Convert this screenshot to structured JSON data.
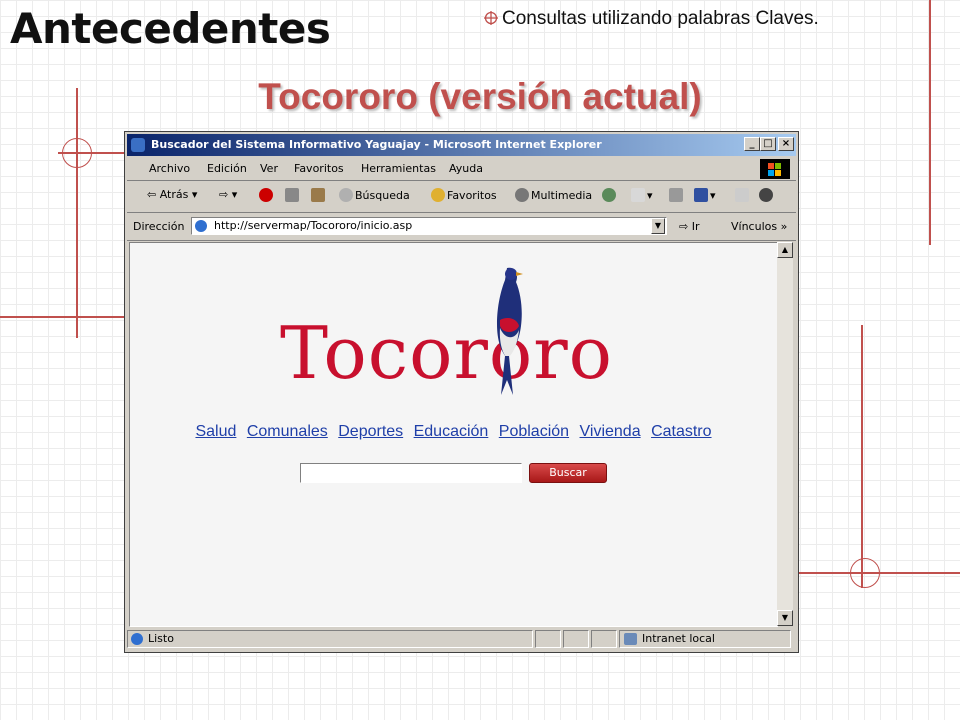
{
  "slide": {
    "title": "Antecedentes",
    "subtitle": "Consultas utilizando palabras Claves.",
    "heading": "Tocororo (versión actual)"
  },
  "browser": {
    "title": "Buscador del Sistema Informativo Yaguajay - Microsoft Internet Explorer",
    "controls": {
      "minimize": "_",
      "maximize": "□",
      "close": "×"
    },
    "menu": [
      "Archivo",
      "Edición",
      "Ver",
      "Favoritos",
      "Herramientas",
      "Ayuda"
    ],
    "toolbar": {
      "back": "Atrás",
      "search": "Búsqueda",
      "favorites": "Favoritos",
      "media": "Multimedia"
    },
    "address": {
      "label": "Dirección",
      "url": "http://servermap/Tocororo/inicio.asp",
      "go": "Ir",
      "links": "Vínculos"
    },
    "status": {
      "text": "Listo",
      "zone": "Intranet local"
    }
  },
  "page": {
    "logo_text": "Tocororo",
    "nav_links": [
      "Salud",
      "Comunales",
      "Deportes",
      "Educación",
      "Población",
      "Vivienda",
      "Catastro"
    ],
    "search_button": "Buscar",
    "search_value": ""
  },
  "colors": {
    "accent": "#c0504d",
    "titlebar": "#0a246a",
    "link": "#1f3fa8",
    "logo": "#c8102e"
  }
}
